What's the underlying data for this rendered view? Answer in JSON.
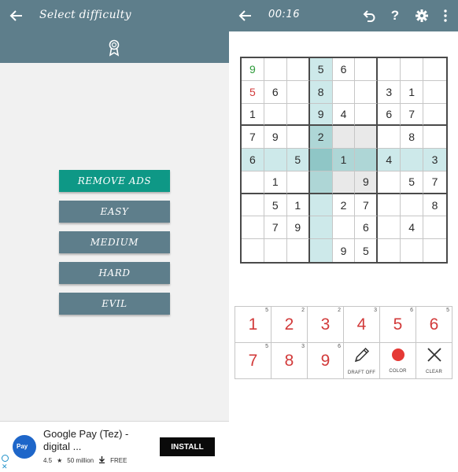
{
  "left": {
    "title": "Select difficulty",
    "buttons": {
      "remove_ads": "REMOVE ADS",
      "easy": "EASY",
      "medium": "MEDIUM",
      "hard": "HARD",
      "evil": "EVIL"
    },
    "ad": {
      "app_name": "Google Pay (Tez) -",
      "app_name_2": "digital ...",
      "icon_label": "Pay",
      "rating": "4.5",
      "downloads": "50 million",
      "price": "FREE",
      "install_label": "INSTALL"
    }
  },
  "right": {
    "timer": "00:16",
    "help_label": "?",
    "board": [
      [
        "9",
        "",
        "",
        "5",
        "6",
        "",
        "",
        "",
        ""
      ],
      [
        "5",
        "6",
        "",
        "8",
        "",
        "",
        "3",
        "1",
        ""
      ],
      [
        "1",
        "",
        "",
        "9",
        "4",
        "",
        "6",
        "7",
        ""
      ],
      [
        "7",
        "9",
        "",
        "2",
        "",
        "",
        "",
        "8",
        ""
      ],
      [
        "6",
        "",
        "5",
        "",
        "1",
        "",
        "4",
        "",
        "3"
      ],
      [
        "",
        "1",
        "",
        "",
        "",
        "9",
        "",
        "5",
        "7"
      ],
      [
        "",
        "5",
        "1",
        "",
        "2",
        "7",
        "",
        "",
        "8"
      ],
      [
        "",
        "7",
        "9",
        "",
        "",
        "6",
        "",
        "4",
        ""
      ],
      [
        "",
        "",
        "",
        "",
        "9",
        "5",
        "",
        "",
        ""
      ]
    ],
    "cell_text_colors": [
      [
        "#2e9b3a",
        "",
        "",
        "",
        "",
        "",
        "",
        "",
        ""
      ],
      [
        "#d23a3a",
        "",
        "",
        "",
        "",
        "",
        "",
        "",
        ""
      ]
    ],
    "cell_backgrounds": [
      [
        "",
        "",
        "",
        "#cde9ea",
        "",
        "",
        "",
        "",
        ""
      ],
      [
        "",
        "",
        "",
        "#cde9ea",
        "",
        "",
        "",
        "",
        ""
      ],
      [
        "",
        "",
        "",
        "#cde9ea",
        "",
        "",
        "",
        "",
        ""
      ],
      [
        "",
        "",
        "",
        "#aed6d6",
        "#e9e9e9",
        "#e9e9e9",
        "",
        "",
        ""
      ],
      [
        "#cde9ea",
        "#cde9ea",
        "#cde9ea",
        "#8fc6c6",
        "#aed6d6",
        "#aed6d6",
        "#cde9ea",
        "#cde9ea",
        "#cde9ea"
      ],
      [
        "",
        "",
        "",
        "#aed6d6",
        "#e9e9e9",
        "#e9e9e9",
        "",
        "",
        ""
      ],
      [
        "",
        "",
        "",
        "#cde9ea",
        "",
        "",
        "",
        "",
        ""
      ],
      [
        "",
        "",
        "",
        "#cde9ea",
        "",
        "",
        "",
        "",
        ""
      ],
      [
        "",
        "",
        "",
        "#cde9ea",
        "",
        "",
        "",
        "",
        ""
      ]
    ],
    "pad": {
      "numbers": [
        {
          "num": "1",
          "count": "5"
        },
        {
          "num": "2",
          "count": "2"
        },
        {
          "num": "3",
          "count": "2"
        },
        {
          "num": "4",
          "count": "3"
        },
        {
          "num": "5",
          "count": "6"
        },
        {
          "num": "6",
          "count": "5"
        },
        {
          "num": "7",
          "count": "5"
        },
        {
          "num": "8",
          "count": "3"
        },
        {
          "num": "9",
          "count": "6"
        }
      ],
      "draft_label": "DRAFT OFF",
      "color_label": "COLOR",
      "clear_label": "CLEAR",
      "color_dot": "#e53935"
    }
  },
  "colors": {
    "header": "#5e7e8b",
    "accent": "#0e9886",
    "number": "#d23a3a"
  }
}
